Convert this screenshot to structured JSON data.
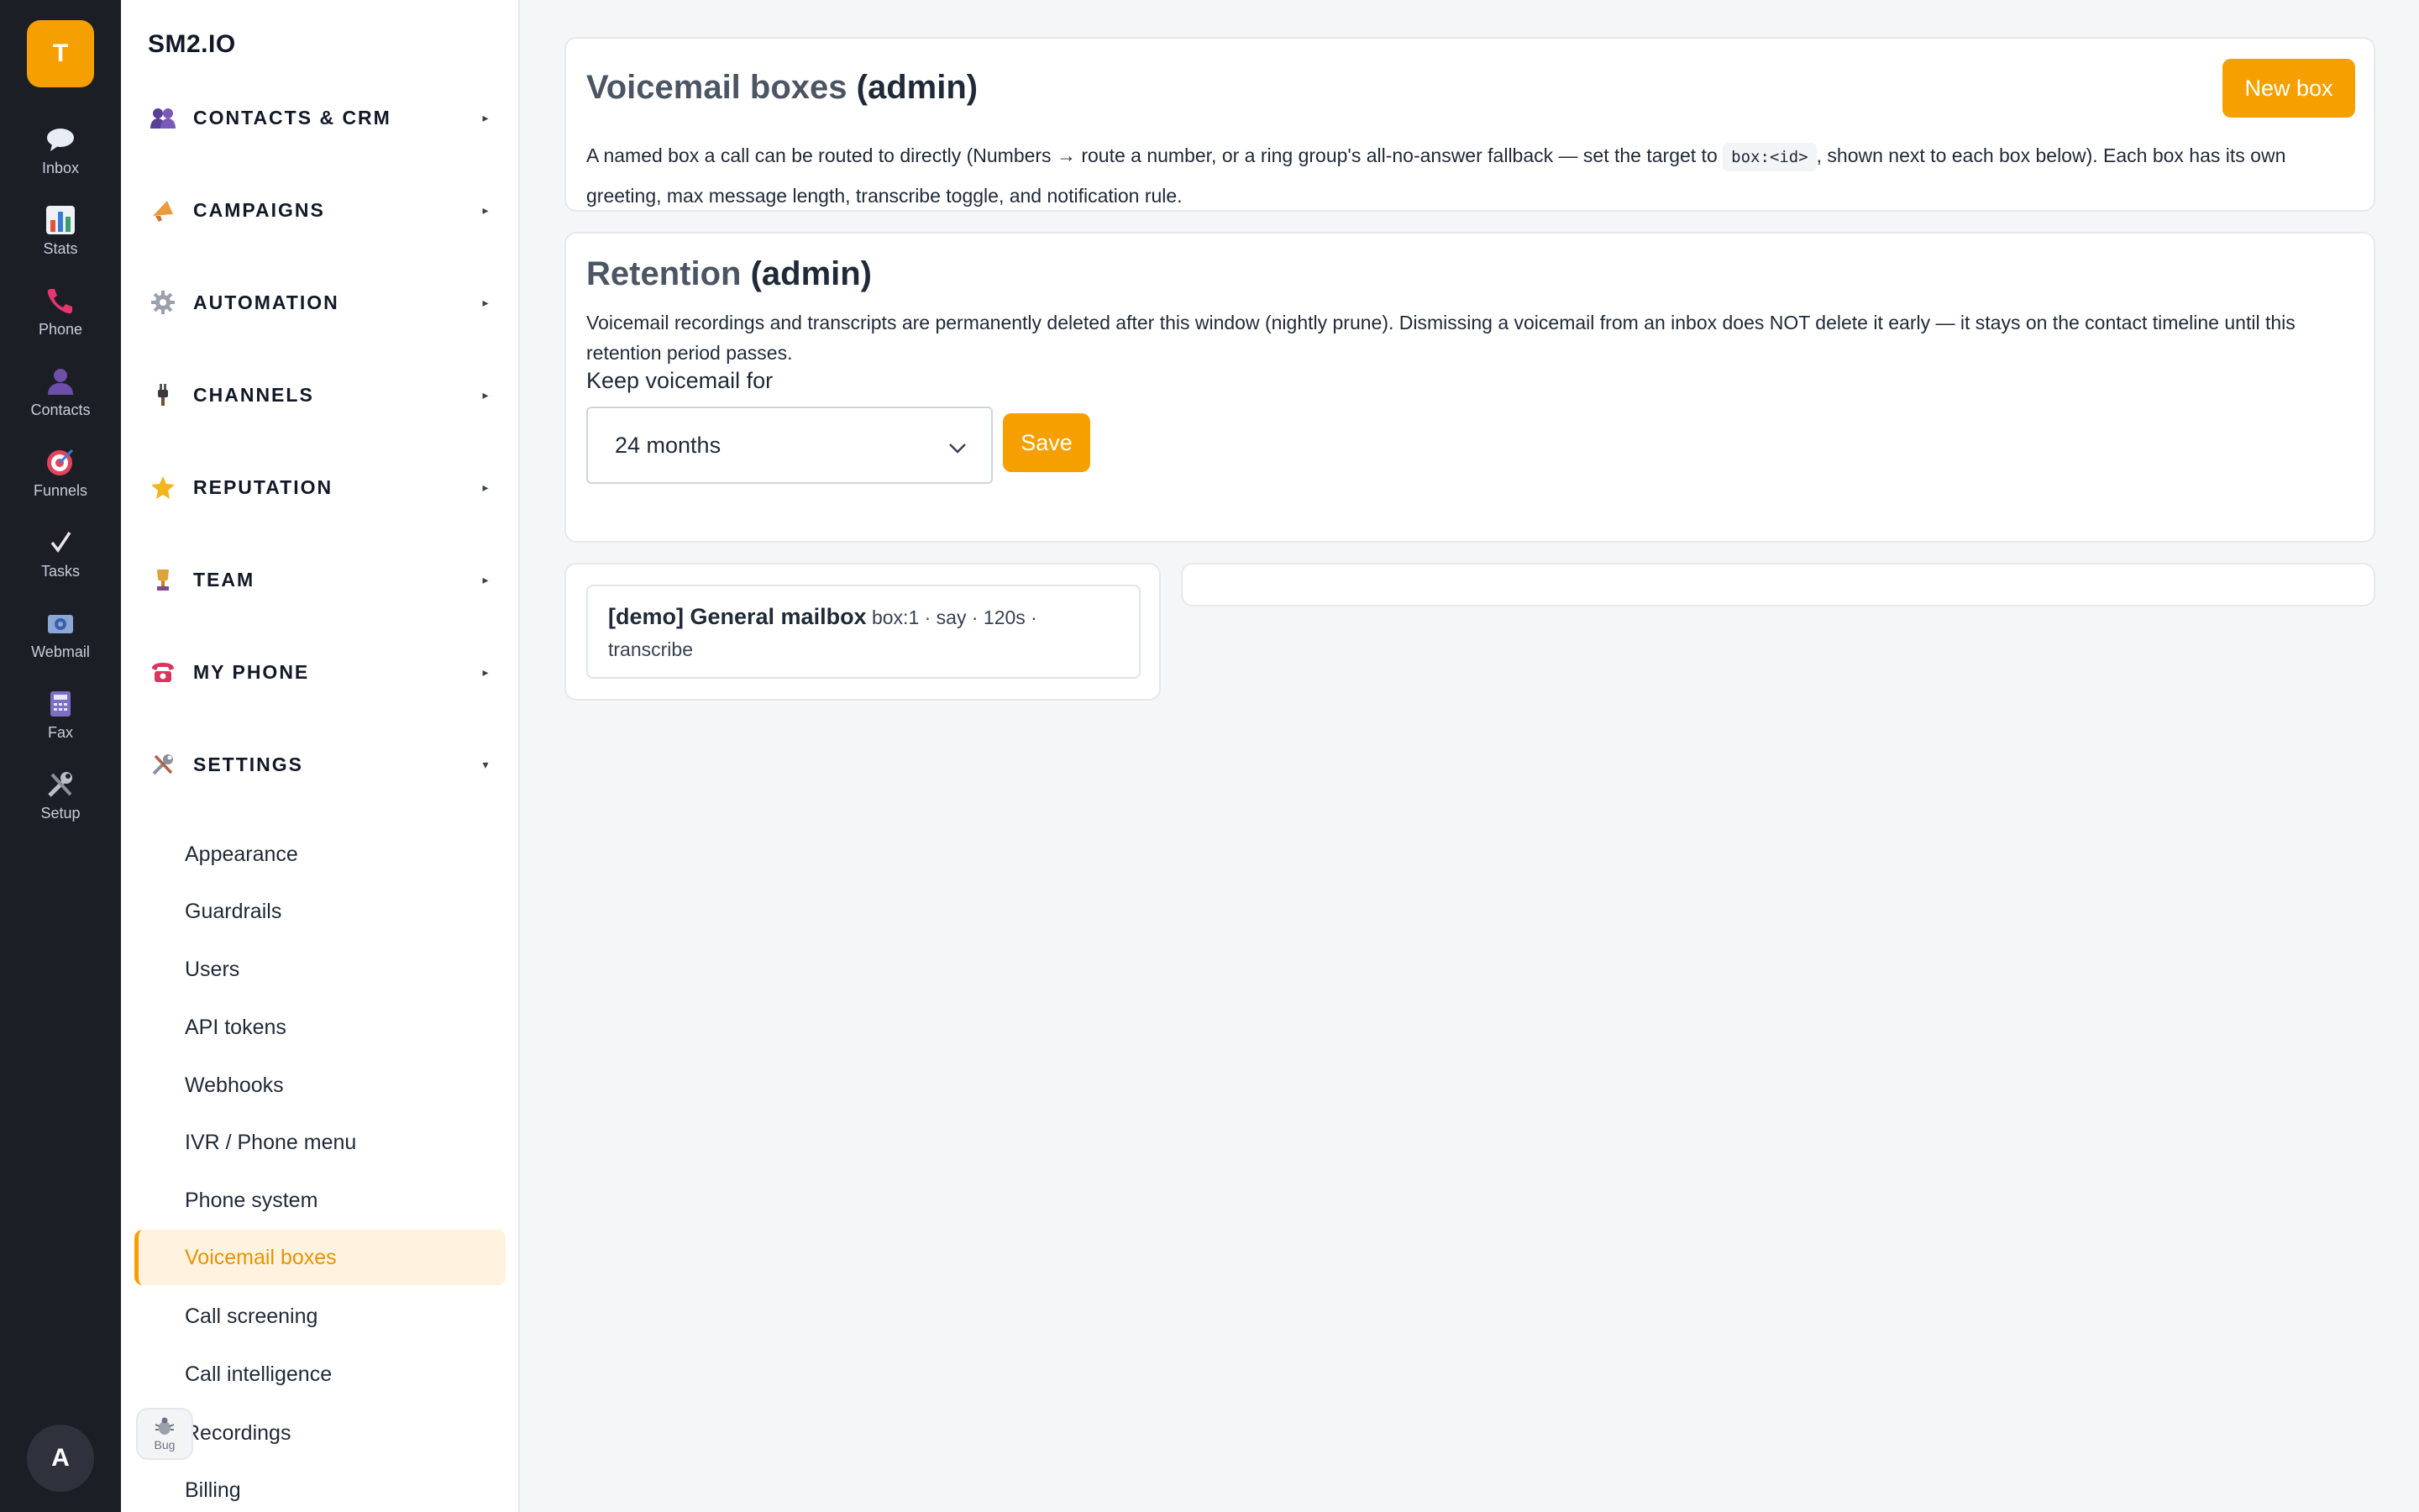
{
  "rail": {
    "logo": "T",
    "items": [
      {
        "label": "Inbox",
        "icon": "chat-bubble-icon"
      },
      {
        "label": "Stats",
        "icon": "bar-chart-icon"
      },
      {
        "label": "Phone",
        "icon": "phone-icon"
      },
      {
        "label": "Contacts",
        "icon": "person-icon"
      },
      {
        "label": "Funnels",
        "icon": "target-icon"
      },
      {
        "label": "Tasks",
        "icon": "checkmark-icon"
      },
      {
        "label": "Webmail",
        "icon": "mail-icon"
      },
      {
        "label": "Fax",
        "icon": "fax-icon"
      },
      {
        "label": "Setup",
        "icon": "tools-icon"
      }
    ],
    "avatar": "A"
  },
  "sidebar": {
    "brand": "SM2.IO",
    "groups": [
      {
        "label": "CONTACTS & CRM",
        "icon": "people-icon",
        "caret": "▸"
      },
      {
        "label": "CAMPAIGNS",
        "icon": "megaphone-icon",
        "caret": "▸"
      },
      {
        "label": "AUTOMATION",
        "icon": "gear-icon",
        "caret": "▸"
      },
      {
        "label": "CHANNELS",
        "icon": "plug-icon",
        "caret": "▸"
      },
      {
        "label": "REPUTATION",
        "icon": "star-icon",
        "caret": "▸"
      },
      {
        "label": "TEAM",
        "icon": "trophy-icon",
        "caret": "▸"
      },
      {
        "label": "MY PHONE",
        "icon": "telephone-icon",
        "caret": "▸"
      },
      {
        "label": "SETTINGS",
        "icon": "tools-icon",
        "caret": "▾"
      }
    ],
    "settings_items": [
      "Appearance",
      "Guardrails",
      "Users",
      "API tokens",
      "Webhooks",
      "IVR / Phone menu",
      "Phone system",
      "Voicemail boxes",
      "Call screening",
      "Call intelligence",
      "Recordings",
      "Billing"
    ],
    "active_item": "Voicemail boxes",
    "bug_label": "Bug"
  },
  "voicemail": {
    "title": "Voicemail boxes",
    "title_suffix": "(admin)",
    "new_button": "New box",
    "desc_part1": "A named box a call can be routed to directly (Numbers → route a number, or a ring group's all-no-answer fallback — set the target to",
    "desc_code": "box:<id>",
    "desc_part2": ", shown next to each box below). Each box has its own greeting, max message length, transcribe toggle, and notification rule."
  },
  "retention": {
    "title": "Retention",
    "title_suffix": "(admin)",
    "description": "Voicemail recordings and transcripts are permanently deleted after this window (nightly prune). Dismissing a voicemail from an inbox does NOT delete it early — it stays on the contact timeline until this retention period passes.",
    "field_label": "Keep voicemail for",
    "selected": "24 months",
    "save_button": "Save"
  },
  "boxes": [
    {
      "name": "[demo] General mailbox",
      "meta": "box:1 · say · 120s ·",
      "meta2": "transcribe"
    }
  ],
  "colors": {
    "accent": "#f5a000",
    "rail_bg": "#1c1e26",
    "active_bg": "#fff3df"
  }
}
